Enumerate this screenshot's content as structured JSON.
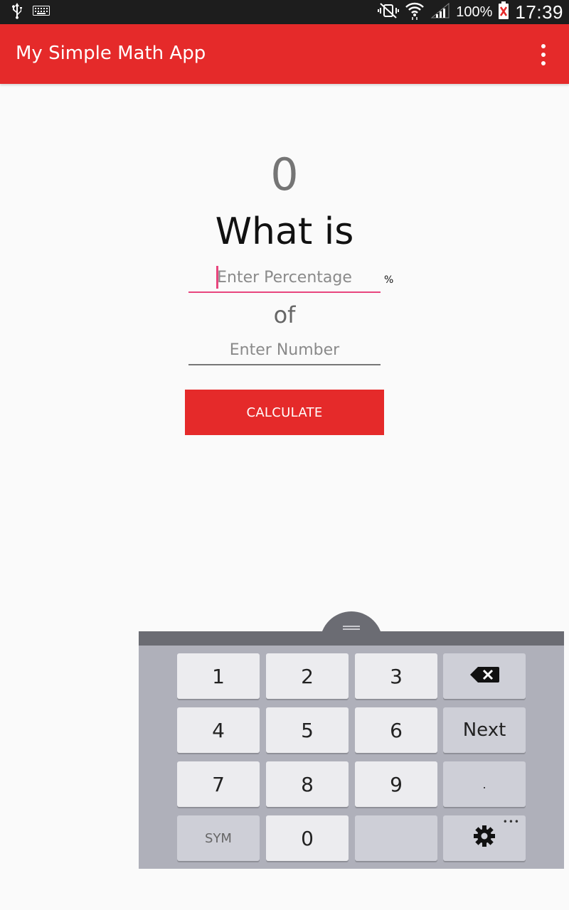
{
  "status_bar": {
    "left_icons": [
      "usb-icon",
      "keyboard-icon"
    ],
    "right_icons": [
      "mute-vibrate-icon",
      "wifi-icon",
      "signal-icon"
    ],
    "battery_percent": "100%",
    "time": "17:39"
  },
  "app_bar": {
    "title": "My Simple Math App",
    "overflow_icon": "more-vert-icon",
    "color": "#e52a2a"
  },
  "main": {
    "result": "0",
    "question": "What is",
    "percentage_input": {
      "placeholder": "Enter Percentage",
      "value": ""
    },
    "percent_sign": "%",
    "of_label": "of",
    "number_input": {
      "placeholder": "Enter Number",
      "value": ""
    },
    "calculate_button": "CALCULATE"
  },
  "keyboard": {
    "keys": [
      [
        "1",
        "2",
        "3",
        "backspace-icon"
      ],
      [
        "4",
        "5",
        "6",
        "Next"
      ],
      [
        "7",
        "8",
        "9",
        "."
      ],
      [
        "SYM",
        "0",
        "",
        "settings-icon"
      ]
    ],
    "k1": "1",
    "k2": "2",
    "k3": "3",
    "k4": "4",
    "k5": "5",
    "k6": "6",
    "k7": "7",
    "k8": "8",
    "k9": "9",
    "k0": "0",
    "next": "Next",
    "dot": ".",
    "sym": "SYM",
    "more": "•••"
  }
}
